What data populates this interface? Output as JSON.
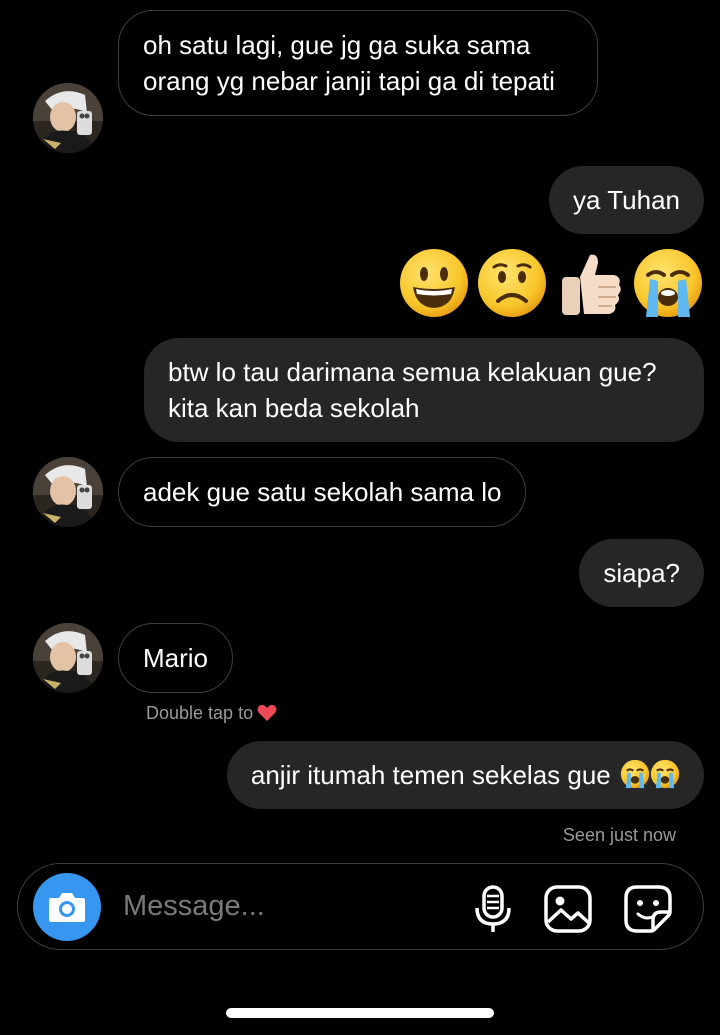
{
  "conversation": {
    "messages": [
      {
        "side": "in",
        "text": "oh satu lagi, gue jg ga suka sama orang yg nebar janji tapi ga di tepati"
      },
      {
        "side": "out",
        "text": "ya Tuhan"
      },
      {
        "side": "out",
        "emojis": [
          "grinning-face",
          "frowning-face",
          "thumbs-up",
          "loudly-crying-face"
        ]
      },
      {
        "side": "out",
        "text": "btw lo tau darimana semua kelakuan gue? kita kan beda sekolah"
      },
      {
        "side": "in",
        "text": "adek gue satu sekolah sama lo"
      },
      {
        "side": "out",
        "text": "siapa?"
      },
      {
        "side": "in",
        "text": "Mario"
      },
      {
        "side": "out",
        "text": "anjir itumah temen sekelas gue"
      }
    ],
    "double_tap_hint": "Double tap to",
    "seen_status": "Seen just now"
  },
  "composer": {
    "placeholder": "Message...",
    "icons": [
      "camera-icon",
      "microphone-icon",
      "gallery-icon",
      "sticker-icon"
    ]
  },
  "colors": {
    "background": "#000000",
    "outgoing_bubble": "#262626",
    "incoming_border": "#3d3d3d",
    "camera_button": "#3797f0",
    "muted_text": "#9a9a9a",
    "heart": "#ed4956"
  }
}
